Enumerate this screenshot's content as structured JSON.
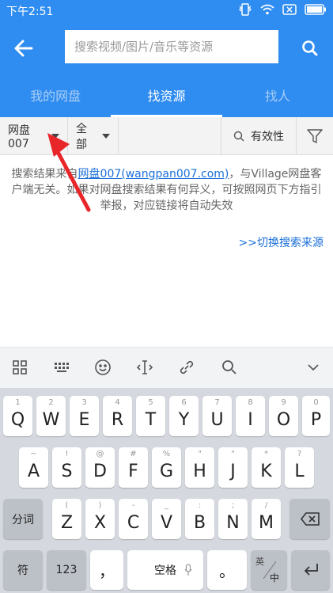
{
  "status_bar": {
    "time": "下午2:51"
  },
  "app_bar": {
    "search_placeholder": "搜索视频/图片/音乐等资源"
  },
  "tabs": [
    {
      "label": "我的网盘",
      "active": false
    },
    {
      "label": "找资源",
      "active": true
    },
    {
      "label": "找人",
      "active": false
    }
  ],
  "filters": {
    "source": "网盘007",
    "category": "全部",
    "validity": "有效性"
  },
  "notice": {
    "prefix": "搜索结果来自",
    "link": "网盘007(wangpan007.com)",
    "suffix": "，与Village网盘客户端无关。如果对网盘搜索结果有何异义，可按照网页下方指引举报，对应链接将自动失效"
  },
  "switch_source": ">>切换搜索来源",
  "keyboard": {
    "row1": [
      {
        "main": "Q",
        "sub": "1"
      },
      {
        "main": "W",
        "sub": "2"
      },
      {
        "main": "E",
        "sub": "3"
      },
      {
        "main": "R",
        "sub": "4"
      },
      {
        "main": "T",
        "sub": "5"
      },
      {
        "main": "Y",
        "sub": "6"
      },
      {
        "main": "U",
        "sub": "7"
      },
      {
        "main": "I",
        "sub": "8"
      },
      {
        "main": "O",
        "sub": "9"
      },
      {
        "main": "P",
        "sub": "0"
      }
    ],
    "row2": [
      {
        "main": "A",
        "sub": "~"
      },
      {
        "main": "S",
        "sub": "!"
      },
      {
        "main": "D",
        "sub": "@"
      },
      {
        "main": "F",
        "sub": "#"
      },
      {
        "main": "G",
        "sub": "%"
      },
      {
        "main": "H",
        "sub": "\""
      },
      {
        "main": "J",
        "sub": "\""
      },
      {
        "main": "K",
        "sub": "*"
      },
      {
        "main": "L",
        "sub": "?"
      }
    ],
    "row3": [
      {
        "main": "Z",
        "sub": "("
      },
      {
        "main": "X",
        "sub": ")"
      },
      {
        "main": "C",
        "sub": "-"
      },
      {
        "main": "V",
        "sub": "_"
      },
      {
        "main": "B",
        "sub": ":"
      },
      {
        "main": "N",
        "sub": ";"
      },
      {
        "main": "M",
        "sub": "/"
      }
    ],
    "fenci": "分词",
    "fu": "符",
    "num": "123",
    "comma": "，",
    "space": "空格",
    "period": "。",
    "lang_top": "英",
    "lang_bottom": "中"
  },
  "colors": {
    "primary": "#2f8cf0",
    "link": "#1a6fd8",
    "arrow": "#e8262a"
  }
}
